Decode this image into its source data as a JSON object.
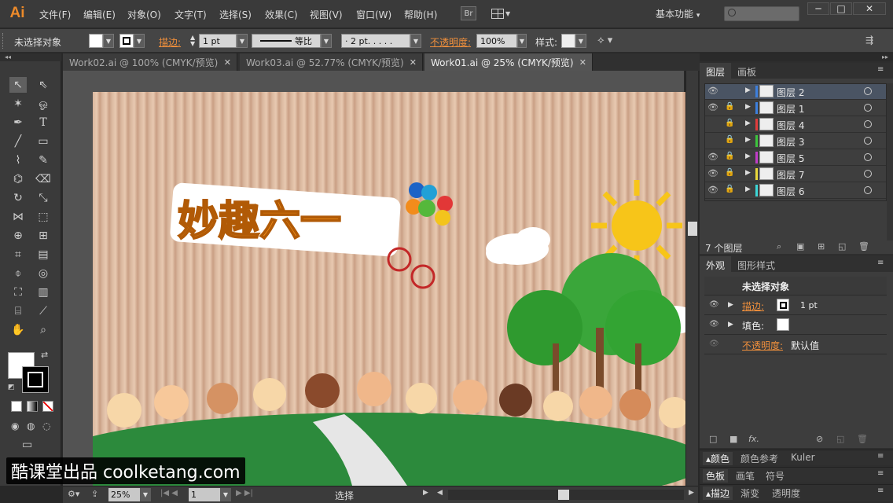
{
  "menubar": {
    "logo": "Ai",
    "menus": [
      "文件(F)",
      "编辑(E)",
      "对象(O)",
      "文字(T)",
      "选择(S)",
      "效果(C)",
      "视图(V)",
      "窗口(W)",
      "帮助(H)"
    ],
    "bridge_btn": "Br",
    "workspace": "基本功能",
    "workspace_arrow": "▾",
    "minimize": "─",
    "maximize": "□",
    "close": "✕"
  },
  "control_bar": {
    "selection_state": "未选择对象",
    "stroke_label": "描边",
    "stroke_value": "1 pt",
    "stroke_profile": "等比",
    "brush_value": "· 2 pt. . . . .",
    "opacity_label": "不透明度",
    "opacity_value": "100%",
    "style_label": "样式:"
  },
  "doc_tabs": [
    {
      "label": "Work02.ai @ 100% (CMYK/预览)",
      "close": "✕",
      "active": false
    },
    {
      "label": "Work03.ai @ 52.77% (CMYK/预览)",
      "close": "✕",
      "active": false
    },
    {
      "label": "Work01.ai @ 25% (CMYK/预览)",
      "close": "✕",
      "active": true
    }
  ],
  "artwork": {
    "title_text": "妙趣六一"
  },
  "status_bar": {
    "zoom": "25%",
    "artboard": "1",
    "tool_name": "选择"
  },
  "layers_panel": {
    "tabs": [
      "图层",
      "画板"
    ],
    "layers": [
      {
        "name": "图层 2",
        "color": "#3d7fdc",
        "visible": true,
        "locked": false,
        "selected": true
      },
      {
        "name": "图层 1",
        "color": "#3d7fdc",
        "visible": true,
        "locked": true,
        "selected": false
      },
      {
        "name": "图层 4",
        "color": "#e03c3c",
        "visible": false,
        "locked": true,
        "selected": false
      },
      {
        "name": "图层 3",
        "color": "#3dc43d",
        "visible": false,
        "locked": true,
        "selected": false
      },
      {
        "name": "图层 5",
        "color": "#c03cc8",
        "visible": true,
        "locked": true,
        "selected": false
      },
      {
        "name": "图层 7",
        "color": "#e8d83c",
        "visible": true,
        "locked": true,
        "selected": false
      },
      {
        "name": "图层 6",
        "color": "#3cd6d6",
        "visible": true,
        "locked": true,
        "selected": false
      }
    ],
    "count_label": "7 个图层"
  },
  "appearance_panel": {
    "tabs": [
      "外观",
      "图形样式"
    ],
    "title": "未选择对象",
    "stroke_label": "描边:",
    "stroke_value": "1 pt",
    "fill_label": "填色:",
    "opacity_label": "不透明度:",
    "opacity_value": "默认值"
  },
  "collapsed_panels": {
    "row1": [
      "颜色",
      "颜色参考",
      "Kuler"
    ],
    "row2": [
      "色板",
      "画笔",
      "符号"
    ],
    "row3": [
      "描边",
      "渐变",
      "透明度"
    ]
  },
  "watermark": "酷课堂出品 coolketang.com"
}
